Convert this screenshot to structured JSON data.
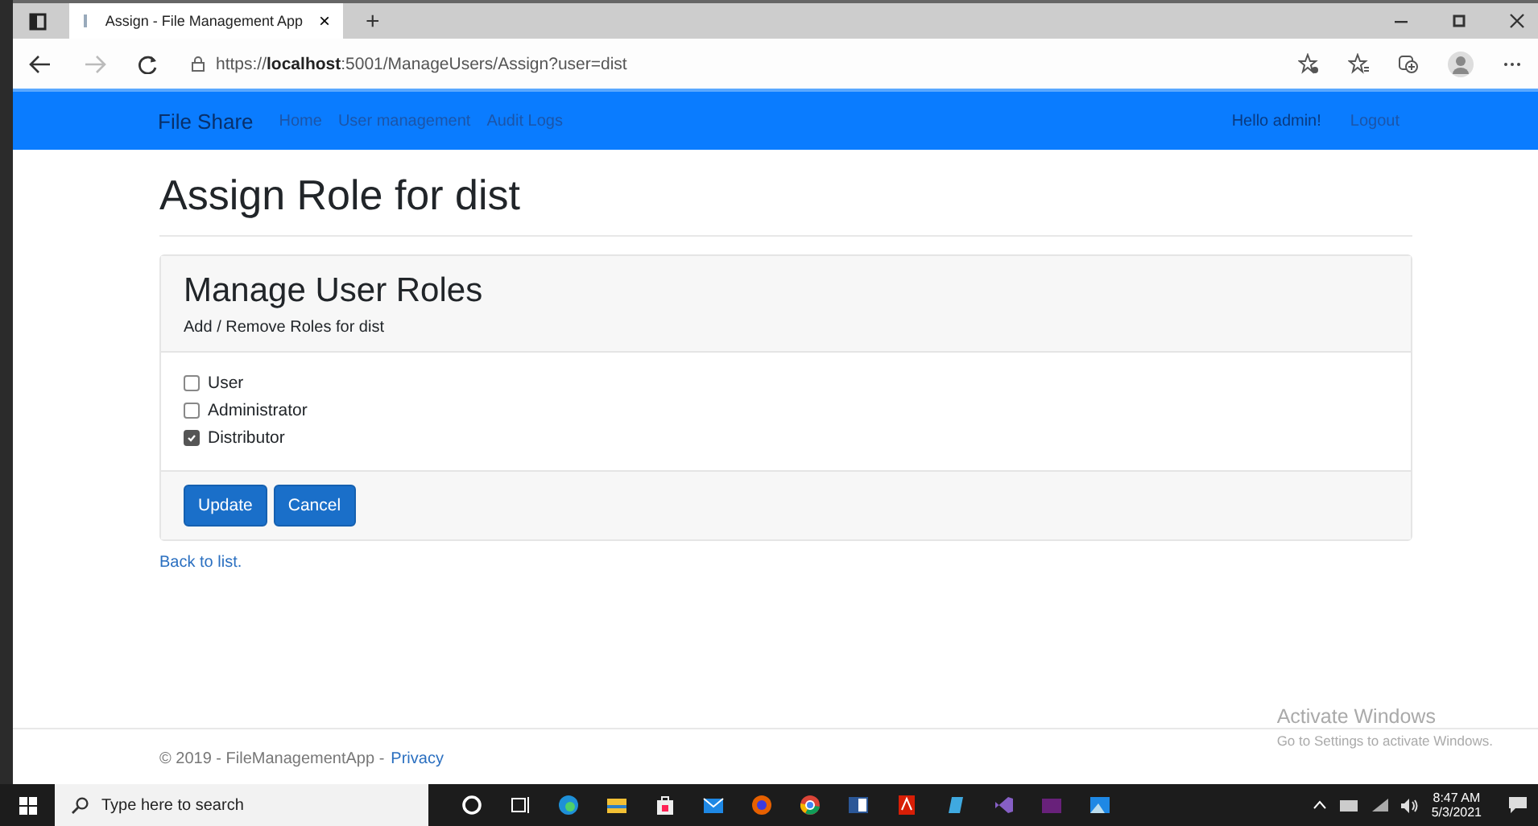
{
  "browser": {
    "tab_title": "Assign - File Management App",
    "tab_close": "×",
    "new_tab": "+",
    "url_host_prefix": "https://",
    "url_host": "localhost",
    "url_rest": ":5001/ManageUsers/Assign?user=dist"
  },
  "navbar": {
    "brand": "File Share",
    "links": [
      "Home",
      "User management",
      "Audit Logs"
    ],
    "greeting": "Hello admin!",
    "logout": "Logout"
  },
  "page": {
    "heading": "Assign Role for dist",
    "card": {
      "title": "Manage User Roles",
      "subtitle": "Add / Remove Roles for dist",
      "roles": [
        {
          "label": "User",
          "checked": false
        },
        {
          "label": "Administrator",
          "checked": false
        },
        {
          "label": "Distributor",
          "checked": true
        }
      ],
      "buttons": [
        "Update",
        "Cancel"
      ]
    },
    "back_link": "Back to list.",
    "footer": {
      "copyright": "© 2019 - FileManagementApp -",
      "privacy": "Privacy"
    }
  },
  "activation": {
    "title": "Activate Windows",
    "subtitle": "Go to Settings to activate Windows."
  },
  "taskbar": {
    "search_placeholder": "Type here to search",
    "time": "8:47 AM",
    "date": "5/3/2021"
  }
}
